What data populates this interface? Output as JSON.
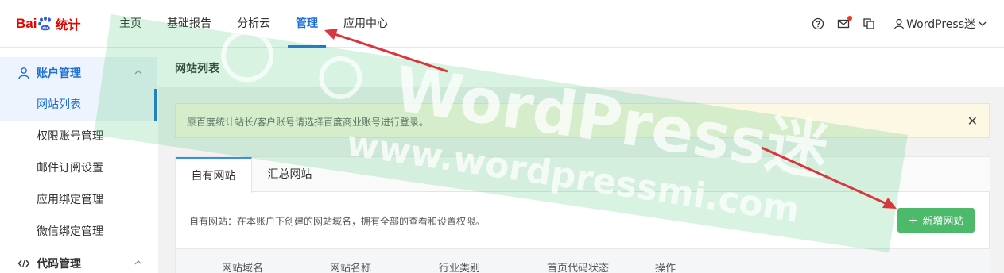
{
  "logo": {
    "text_latin": "Bai",
    "text_cn": "统计"
  },
  "nav": {
    "items": [
      {
        "label": "主页"
      },
      {
        "label": "基础报告"
      },
      {
        "label": "分析云"
      },
      {
        "label": "管理"
      },
      {
        "label": "应用中心"
      }
    ],
    "active_index": 3
  },
  "top_icons": [
    "help-icon",
    "mail-icon",
    "copy-icon"
  ],
  "user": {
    "name": "WordPress迷"
  },
  "sidebar": {
    "group1": {
      "label": "账户管理",
      "icon": "user-icon"
    },
    "items": [
      {
        "label": "网站列表"
      },
      {
        "label": "权限账号管理"
      },
      {
        "label": "邮件订阅设置"
      },
      {
        "label": "应用绑定管理"
      },
      {
        "label": "微信绑定管理"
      }
    ],
    "group2": {
      "label": "代码管理",
      "icon": "code-icon"
    }
  },
  "page": {
    "title": "网站列表"
  },
  "notice": {
    "text": "原百度统计站长/客户账号请选择百度商业账号进行登录。",
    "close": "✕"
  },
  "tabs": [
    {
      "label": "自有网站"
    },
    {
      "label": "汇总网站"
    }
  ],
  "desc": "自有网站：在本账户下创建的网站域名，拥有全部的查看和设置权限。",
  "add_button": {
    "label": "新增网站",
    "icon": "+"
  },
  "table": {
    "headers": [
      "网站域名",
      "网站名称",
      "行业类别",
      "首页代码状态",
      "操作"
    ]
  },
  "watermark": {
    "text1": "WordPress迷",
    "text2": "www.wordpressmi.com"
  },
  "colors": {
    "brand_red": "#e10602",
    "accent_blue": "#1d6ed8",
    "button_green": "#4cb96b",
    "arrow_red": "#d9363e"
  }
}
